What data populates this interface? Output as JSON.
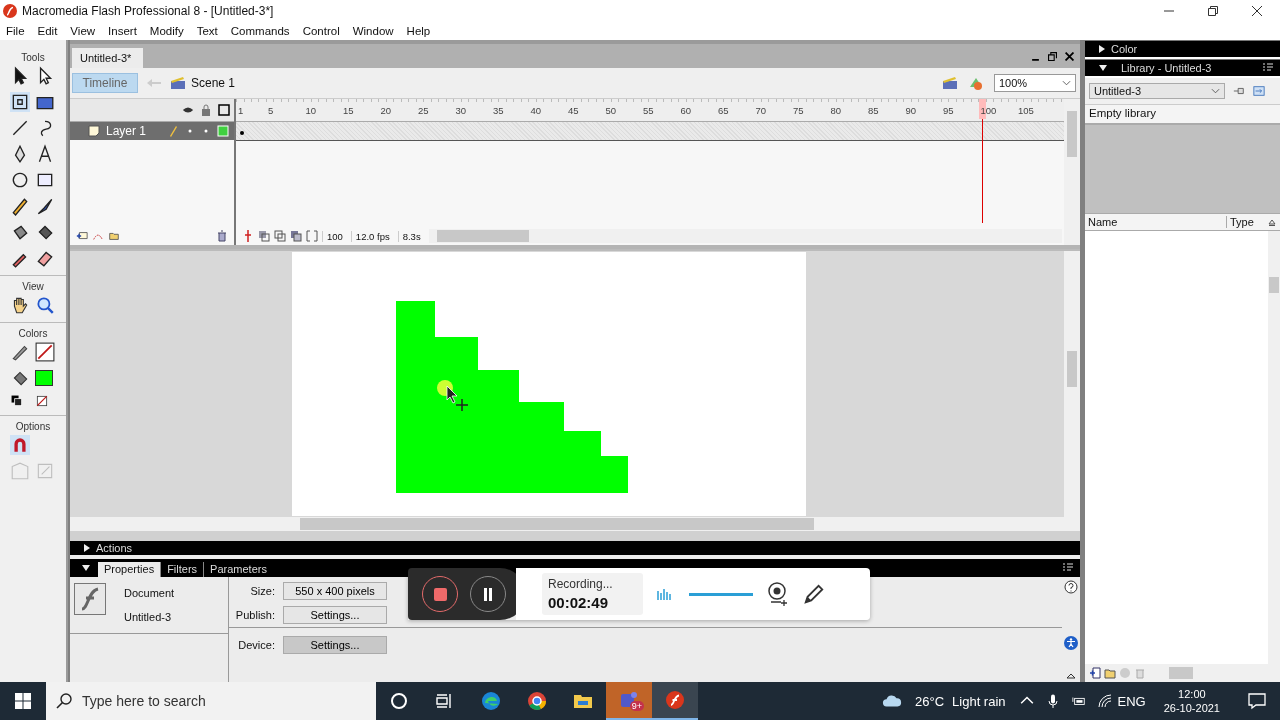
{
  "window": {
    "title": "Macromedia Flash Professional 8 - [Untitled-3*]"
  },
  "menu": [
    "File",
    "Edit",
    "View",
    "Insert",
    "Modify",
    "Text",
    "Commands",
    "Control",
    "Window",
    "Help"
  ],
  "tools": {
    "title": "Tools",
    "sections": [
      "View",
      "Colors",
      "Options"
    ]
  },
  "document_tab": {
    "label": "Untitled-3*"
  },
  "edit_bar": {
    "timeline_button": "Timeline",
    "scene": "Scene 1",
    "zoom": "100%"
  },
  "timeline": {
    "ruler": [
      "1",
      "5",
      "10",
      "15",
      "20",
      "25",
      "30",
      "35",
      "40",
      "45",
      "50",
      "55",
      "60",
      "65",
      "70",
      "75",
      "80",
      "85",
      "90",
      "95",
      "100",
      "105"
    ],
    "layers": [
      {
        "name": "Layer 1",
        "selected": true
      }
    ],
    "current_frame": "100",
    "frame_rate": "12.0 fps",
    "elapsed": "8.3s"
  },
  "actions": {
    "title": "Actions",
    "expanded": false
  },
  "properties": {
    "expanded": true,
    "tabs": [
      {
        "label": "Properties",
        "selected": true
      },
      {
        "label": "Filters",
        "selected": false
      },
      {
        "label": "Parameters",
        "selected": false
      }
    ],
    "kind_label": "Document",
    "doc_name": "Untitled-3",
    "fields": [
      {
        "label": "Size:",
        "button": "550 x 400 pixels"
      },
      {
        "label": "Publish:",
        "button": "Settings..."
      },
      {
        "label": "Device:",
        "button": "Settings..."
      }
    ]
  },
  "recorder": {
    "status": "Recording...",
    "time": "00:02:49",
    "volume": {
      "level": 1
    }
  },
  "color_panel": {
    "title": "Color",
    "expanded": false
  },
  "library": {
    "title": "Library - Untitled-3",
    "expanded": true,
    "document": "Untitled-3",
    "status": "Empty library",
    "columns": [
      "Name",
      "Type"
    ]
  },
  "taskbar": {
    "search_placeholder": "Type here to search",
    "teams_badge": "9+",
    "temperature": "26°C",
    "weather": "Light rain",
    "language": "ENG",
    "time": "12:00",
    "date": "26-10-2021"
  }
}
